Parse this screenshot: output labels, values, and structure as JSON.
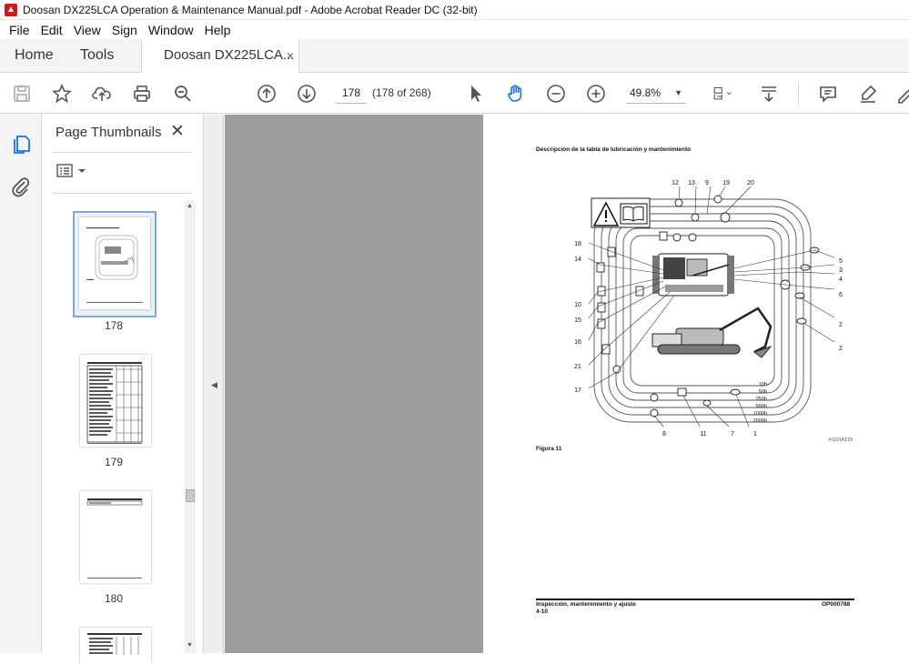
{
  "window": {
    "title": "Doosan DX225LCA Operation & Maintenance Manual.pdf - Adobe Acrobat Reader DC (32-bit)",
    "app_icon": "acrobat-icon"
  },
  "menu": [
    "File",
    "Edit",
    "View",
    "Sign",
    "Window",
    "Help"
  ],
  "tabs": {
    "home": "Home",
    "tools": "Tools",
    "document": "Doosan DX225LCA...",
    "close_glyph": "×"
  },
  "toolbar": {
    "current_page": "178",
    "page_count": "(178 of 268)",
    "zoom": "49.8%",
    "icons": [
      "save-icon",
      "bookmark-star-icon",
      "upload-share-icon",
      "print-icon",
      "zoom-search-icon",
      "page-up-icon",
      "page-down-icon",
      "select-arrow-icon",
      "hand-tool-icon",
      "zoom-out-icon",
      "zoom-in-icon",
      "fit-page-icon",
      "scroll-mode-icon",
      "comment-icon",
      "highlight-pen-icon",
      "sign-icon"
    ]
  },
  "left_rail": {
    "icons": [
      "page-thumbnails-icon",
      "attachments-icon"
    ]
  },
  "thumbnails_panel": {
    "title": "Page Thumbnails",
    "close_glyph": "✕",
    "pages": [
      {
        "label": "178",
        "selected": true
      },
      {
        "label": "179",
        "selected": false
      },
      {
        "label": "180",
        "selected": false
      },
      {
        "label": "",
        "selected": false
      }
    ]
  },
  "page": {
    "heading": "Descripción de la tabla de lubricación y mantenimiento",
    "figure_caption": "Figura 11",
    "figure_code": "FG014179",
    "footer_left_1": "Inspección, mantenimiento y ajuste",
    "footer_left_2": "4-10",
    "footer_right": "OP000788",
    "callouts_top": [
      "12",
      "13",
      "9",
      "19",
      "20"
    ],
    "callouts_left": [
      "18",
      "14",
      "10",
      "15",
      "16",
      "21",
      "17"
    ],
    "callouts_right": [
      "5",
      "3",
      "4",
      "6",
      "2",
      "2"
    ],
    "callouts_bottom": [
      "8",
      "11",
      "7",
      "1"
    ],
    "intervals": [
      "10h",
      "50h",
      "250h",
      "500h",
      "1000h",
      "2000h"
    ]
  }
}
